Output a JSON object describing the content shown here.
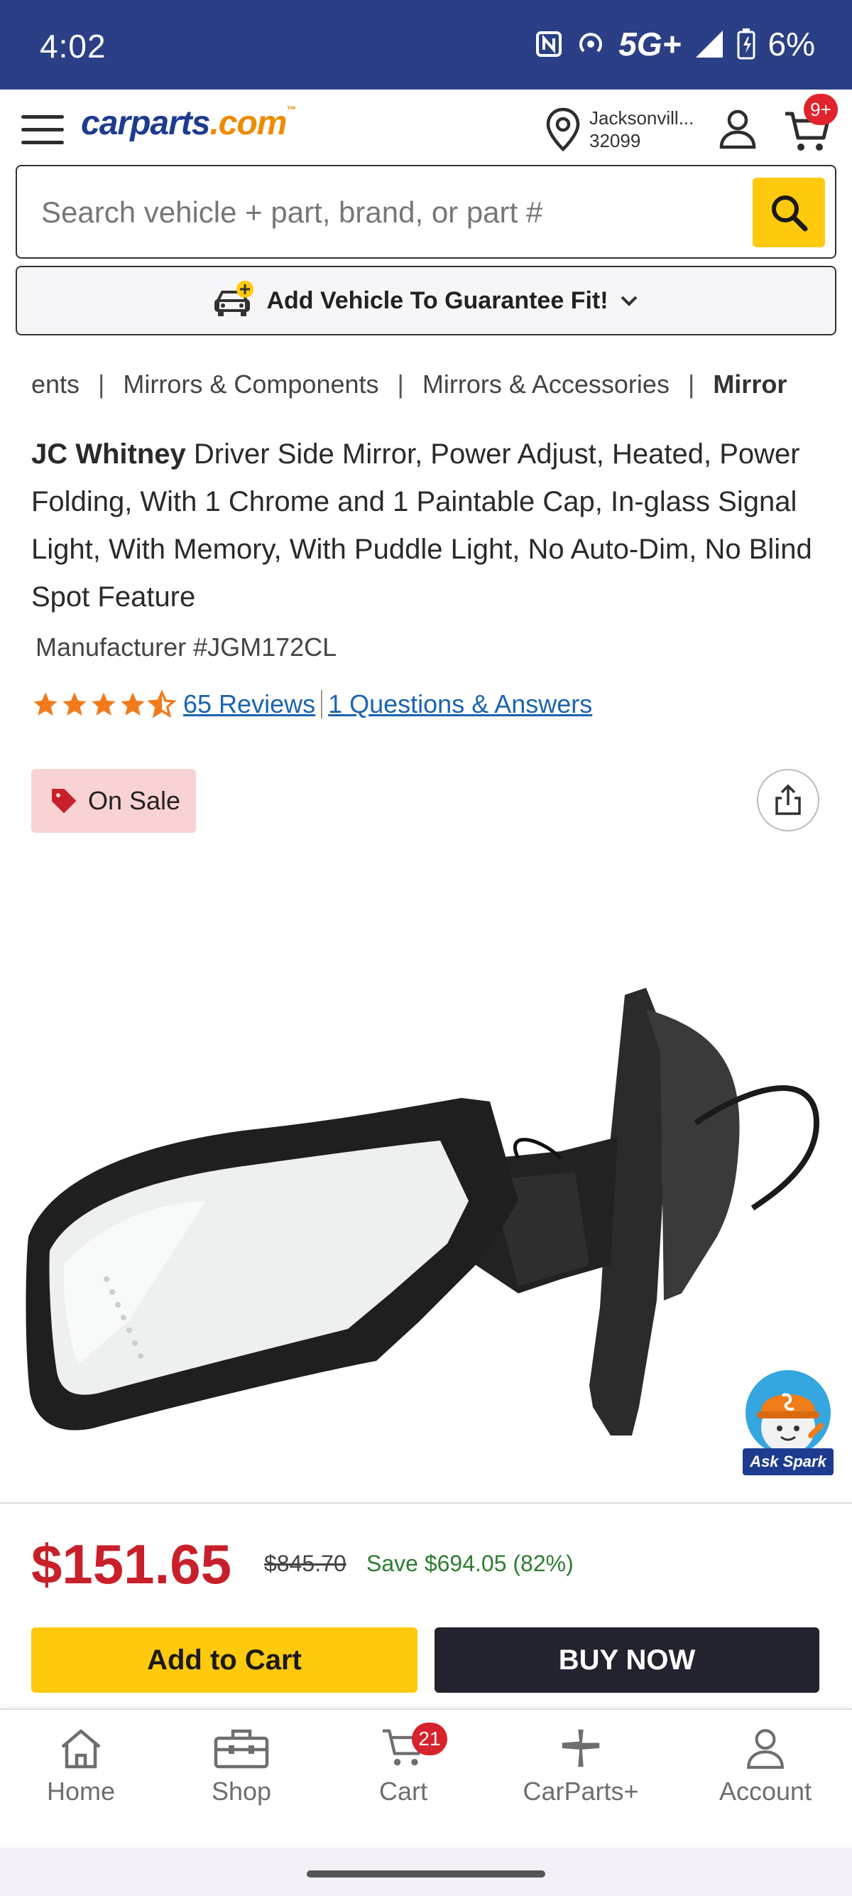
{
  "status_bar": {
    "time": "4:02",
    "network": "5G+",
    "battery": "6%"
  },
  "header": {
    "logo_brand": "carparts",
    "logo_tld": ".com",
    "logo_tm": "™",
    "location_city": "Jacksonvill...",
    "location_zip": "32099",
    "cart_badge": "9+"
  },
  "search": {
    "placeholder": "Search vehicle + part, brand, or part #"
  },
  "vehicle_bar": {
    "label": "Add Vehicle To Guarantee Fit!"
  },
  "breadcrumb": {
    "items": [
      "ents",
      "Mirrors & Components",
      "Mirrors & Accessories",
      "Mirror"
    ],
    "separator": "|"
  },
  "product": {
    "brand": "JC Whitney",
    "title": "Driver Side Mirror, Power Adjust, Heated, Power Folding, With 1 Chrome and 1 Paintable Cap, In-glass Signal Light, With Memory, With Puddle Light, No Auto-Dim, No Blind Spot Feature",
    "manufacturer_label": "Manufacturer #",
    "manufacturer_number": "JGM172CL",
    "rating": 4.5,
    "reviews_link": "65 Reviews",
    "qa_link": "1 Questions & Answers",
    "sale_badge": "On Sale",
    "ask_spark_label": "Ask Spark"
  },
  "pricing": {
    "price": "$151.65",
    "original_price": "$845.70",
    "savings": "Save $694.05 (82%)",
    "add_to_cart": "Add to Cart",
    "buy_now": "BUY NOW"
  },
  "bottom_nav": {
    "home": "Home",
    "shop": "Shop",
    "cart": "Cart",
    "cart_count": "21",
    "carparts_plus": "CarParts+",
    "account": "Account"
  },
  "colors": {
    "status_bar": "#2b3f86",
    "brand_blue": "#1d3b8f",
    "brand_orange": "#f08a00",
    "accent_yellow": "#ffc90d",
    "price_red": "#c8202a",
    "save_green": "#2e7d32",
    "link_blue": "#1b64b0"
  },
  "icons": [
    "menu-icon",
    "location-pin-icon",
    "account-icon",
    "cart-icon",
    "search-icon",
    "car-add-icon",
    "chevron-down-icon",
    "star-icon",
    "price-tag-icon",
    "share-icon",
    "home-icon",
    "toolbox-icon",
    "carparts-plus-icon"
  ]
}
